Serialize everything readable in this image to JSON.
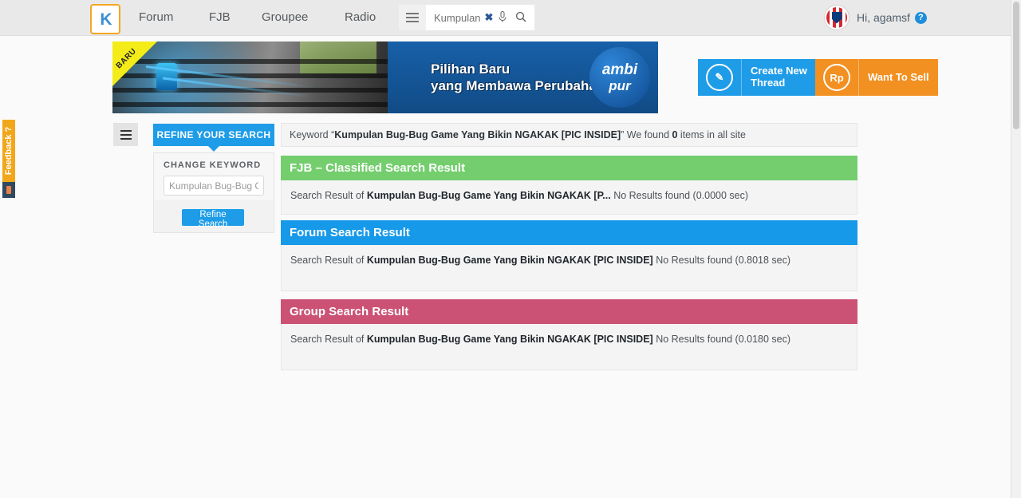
{
  "nav": {
    "logo_letter": "K",
    "links": [
      {
        "label": "Forum"
      },
      {
        "label": "FJB"
      },
      {
        "label": "Groupee"
      },
      {
        "label": "Radio"
      }
    ],
    "search": {
      "value": "Kumpulan",
      "clear_glyph": "✖",
      "mic_glyph": "⭡",
      "magnifier_glyph": "⚲"
    },
    "user": {
      "greeting": "Hi, agamsf",
      "help_glyph": "?"
    }
  },
  "feedback": {
    "label": "Feedback ?"
  },
  "banner": {
    "ribbon": "BARU",
    "headline_line1": "Pilihan Baru",
    "headline_line2": "yang Membawa Perubahan!",
    "brand_line1": "ambi",
    "brand_line2": "pur"
  },
  "actions": {
    "create_thread": {
      "label": "Create New\nThread",
      "icon_glyph": "✎",
      "color": "#1e9ce8"
    },
    "want_to_sell": {
      "label": "Want To Sell",
      "icon_glyph": "Rp",
      "color": "#f29021"
    }
  },
  "refine": {
    "header": "REFINE YOUR SEARCH",
    "change_keyword_label": "CHANGE KEYWORD",
    "keyword_value": "Kumpulan Bug-Bug Game Yang Bikin NGAKAK [PIC INSIDE]",
    "keyword_placeholder": "Kumpulan Bug-Bug G",
    "button_label": "Refine Search"
  },
  "keyword_bar": {
    "prefix": "Keyword “",
    "keyword": "Kumpulan Bug-Bug Game Yang Bikin NGAKAK [PIC INSIDE]",
    "middle": "” We found ",
    "count": "0",
    "suffix": " items in all site"
  },
  "sections": [
    {
      "title": "FJB – Classified Search Result",
      "color": "#74ce6e",
      "prefix": "Search Result of ",
      "keyword": "Kumpulan Bug-Bug Game Yang Bikin NGAKAK [P...",
      "status": " No Results found (0.0000 sec)"
    },
    {
      "title": "Forum Search Result",
      "color": "#1699e8",
      "prefix": "Search Result of ",
      "keyword": "Kumpulan Bug-Bug Game Yang Bikin NGAKAK [PIC INSIDE]",
      "status": " No Results found (0.8018 sec)"
    },
    {
      "title": "Group Search Result",
      "color": "#cb5275",
      "prefix": "Search Result of ",
      "keyword": "Kumpulan Bug-Bug Game Yang Bikin NGAKAK [PIC INSIDE]",
      "status": " No Results found (0.0180 sec)"
    }
  ]
}
